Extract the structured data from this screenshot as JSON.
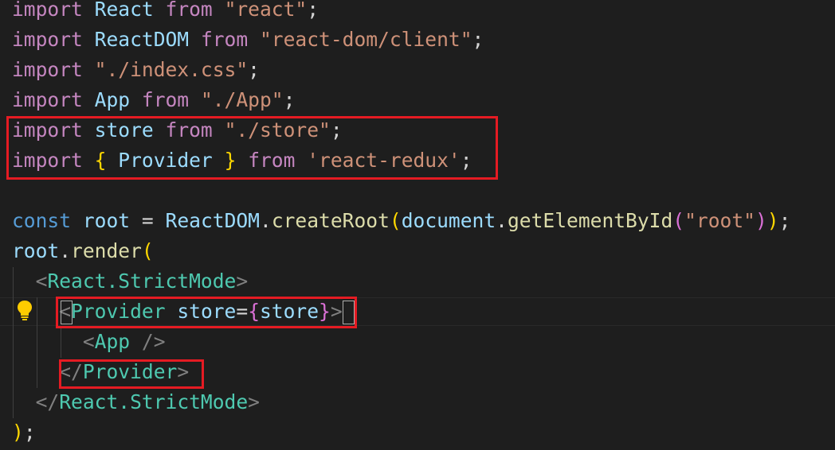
{
  "code": {
    "l1": {
      "kw": "import",
      "name": "React",
      "from": "from",
      "src": "\"react\"",
      "end": ";"
    },
    "l2": {
      "kw": "import",
      "name": "ReactDOM",
      "from": "from",
      "src": "\"react-dom/client\"",
      "end": ";"
    },
    "l3": {
      "kw": "import",
      "src": "\"./index.css\"",
      "end": ";"
    },
    "l4": {
      "kw": "import",
      "name": "App",
      "from": "from",
      "src": "\"./App\"",
      "end": ";"
    },
    "l5": {
      "kw": "import",
      "name": "store",
      "from": "from",
      "src": "\"./store\"",
      "end": ";"
    },
    "l6": {
      "kw": "import",
      "open": "{",
      "name": "Provider",
      "close": "}",
      "from": "from",
      "src": "'react-redux'",
      "end": ";"
    },
    "l8": {
      "kw": "const",
      "name": "root",
      "eq": "=",
      "obj": "ReactDOM",
      "dot": ".",
      "fn": "createRoot",
      "p1": "(",
      "obj2": "document",
      "dot2": ".",
      "fn2": "getElementById",
      "p2": "(",
      "arg": "\"root\"",
      "p2c": ")",
      "p1c": ")",
      "end": ";"
    },
    "l9": {
      "obj": "root",
      "dot": ".",
      "fn": "render",
      "p": "("
    },
    "l10": {
      "lt": "<",
      "tag": "React.StrictMode",
      "gt": ">"
    },
    "l11": {
      "lt": "<",
      "tag": "Provider",
      "attr": "store",
      "eq": "=",
      "ob": "{",
      "val": "store",
      "cb": "}",
      "gt": ">"
    },
    "l12": {
      "lt": "<",
      "tag": "App",
      "close": "/>"
    },
    "l13": {
      "lt": "</",
      "tag": "Provider",
      "gt": ">"
    },
    "l14": {
      "lt": "</",
      "tag": "React.StrictMode",
      "gt": ">"
    },
    "l15": {
      "p": ")",
      "end": ";"
    }
  },
  "colors": {
    "background": "#1e1e1e",
    "keyword": "#c586c0",
    "storage": "#569cd6",
    "variable": "#9cdcfe",
    "string": "#ce9178",
    "function": "#dcdcaa",
    "jsx_tag": "#4ec9b0",
    "highlight_box": "#e51b23"
  },
  "icons": {
    "gutter": "lightbulb-icon"
  }
}
